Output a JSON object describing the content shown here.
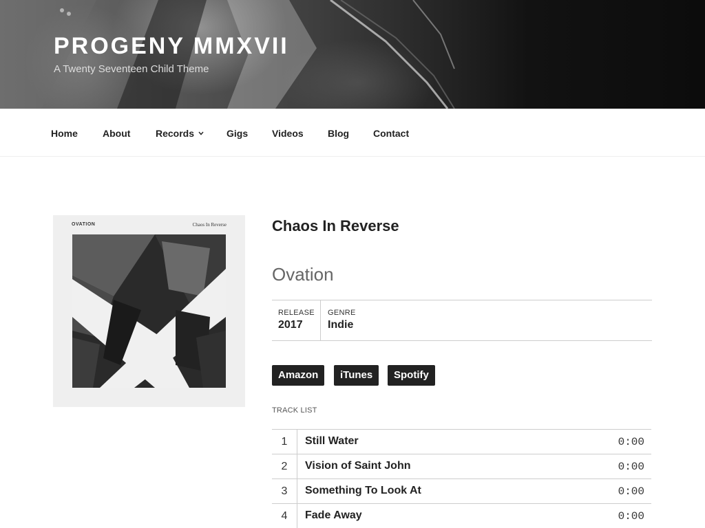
{
  "header": {
    "site_title": "PROGENY MMXVII",
    "site_description": "A Twenty Seventeen Child Theme"
  },
  "nav": {
    "items": [
      {
        "label": "Home"
      },
      {
        "label": "About"
      },
      {
        "label": "Records",
        "has_submenu": true
      },
      {
        "label": "Gigs"
      },
      {
        "label": "Videos"
      },
      {
        "label": "Blog"
      },
      {
        "label": "Contact"
      }
    ]
  },
  "record": {
    "cover": {
      "label_left": "OVATION",
      "label_right": "Chaos In Reverse"
    },
    "title": "Chaos In Reverse",
    "artist": "Ovation",
    "meta": {
      "release_label": "RELEASE",
      "release_value": "2017",
      "genre_label": "GENRE",
      "genre_value": "Indie"
    },
    "buy_links": [
      {
        "label": "Amazon"
      },
      {
        "label": "iTunes"
      },
      {
        "label": "Spotify"
      }
    ],
    "tracklist_label": "TRACK LIST",
    "tracks": [
      {
        "number": "1",
        "title": "Still Water",
        "duration": "0:00"
      },
      {
        "number": "2",
        "title": "Vision of Saint John",
        "duration": "0:00"
      },
      {
        "number": "3",
        "title": "Something To Look At",
        "duration": "0:00"
      },
      {
        "number": "4",
        "title": "Fade Away",
        "duration": "0:00"
      }
    ]
  },
  "icons": {
    "submenu_indicator": "chevron-down-icon"
  },
  "colors": {
    "text": "#222222",
    "button_bg": "#222222",
    "button_text": "#ffffff",
    "muted": "#666666",
    "border": "#cccccc"
  }
}
